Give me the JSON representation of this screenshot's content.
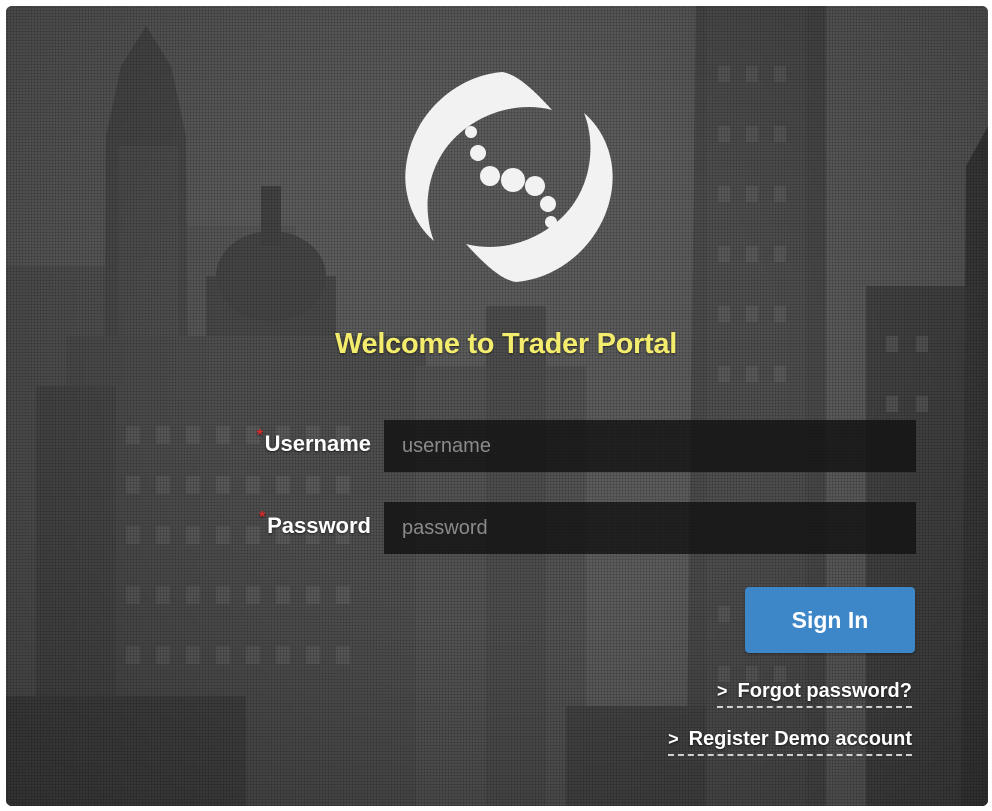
{
  "header": {
    "welcome_text": "Welcome to Trader Portal"
  },
  "logo": {
    "icon": "swirl-logo-icon"
  },
  "form": {
    "username": {
      "label": "Username",
      "required_mark": "*",
      "placeholder": "username",
      "value": ""
    },
    "password": {
      "label": "Password",
      "required_mark": "*",
      "placeholder": "password",
      "value": ""
    },
    "submit_label": "Sign In"
  },
  "links": {
    "chevron": ">",
    "forgot_password": "Forgot password?",
    "register_demo": "Register Demo account"
  },
  "colors": {
    "welcome_text": "#f4ec6d",
    "accent_button": "#3d86c8",
    "required_mark": "#d92b2b",
    "input_background": "#121212"
  }
}
